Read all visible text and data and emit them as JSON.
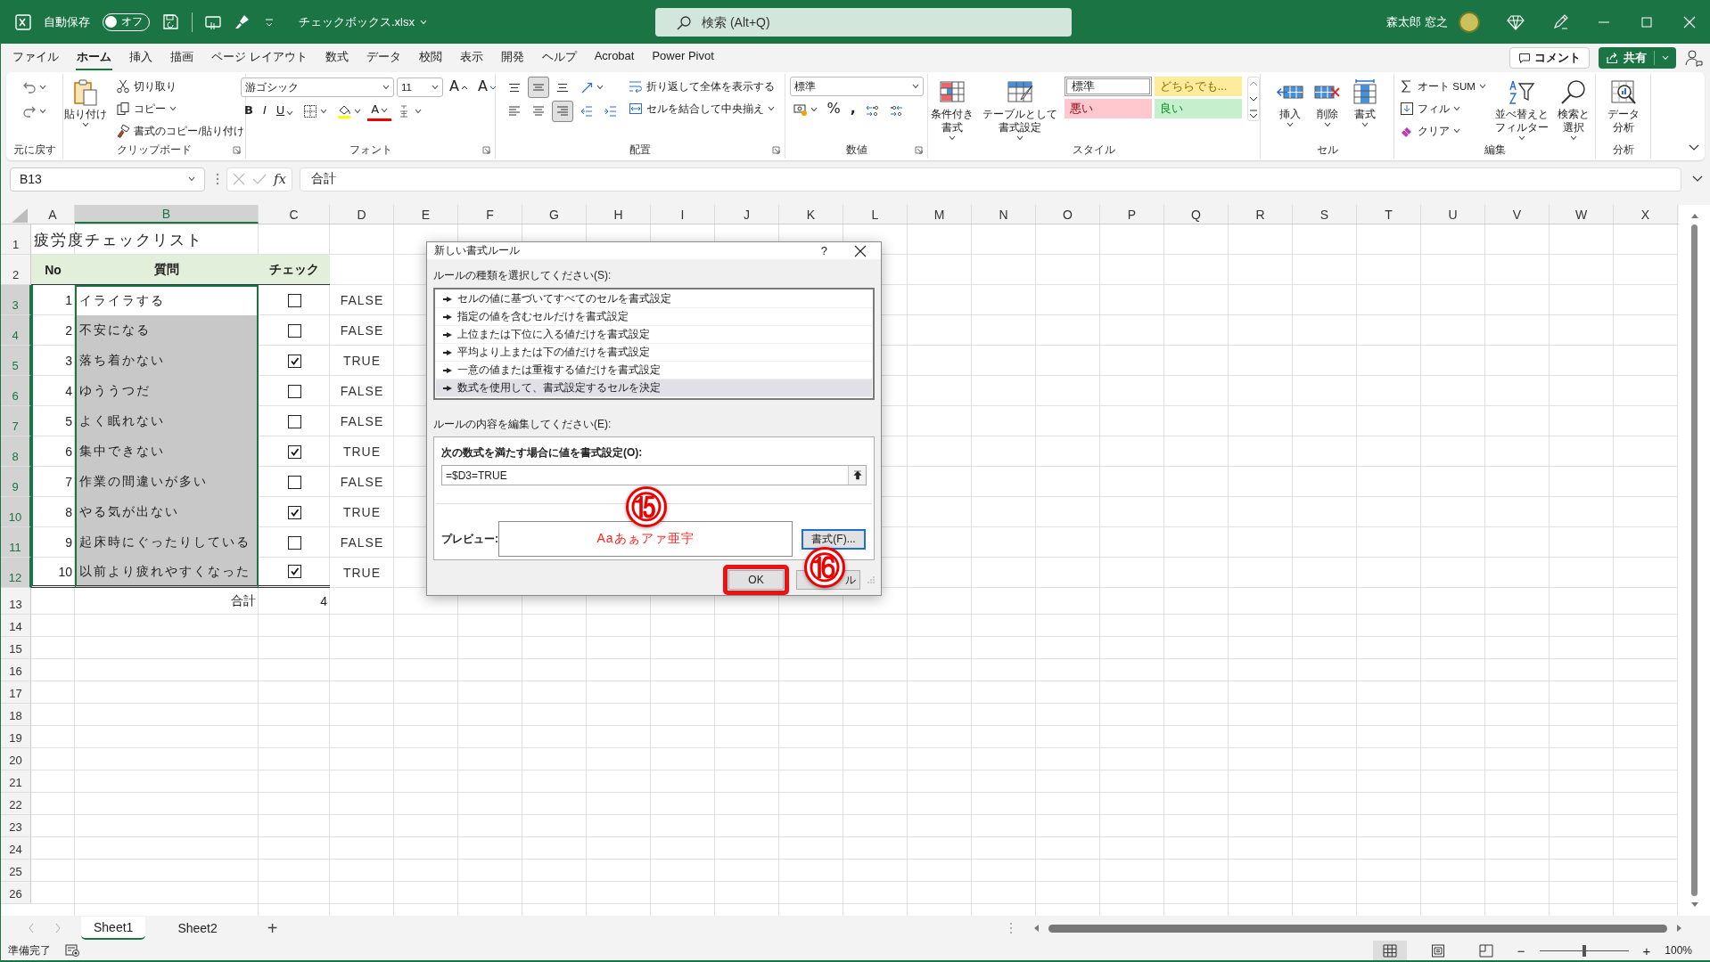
{
  "title_bar": {
    "autosave_label": "自動保存",
    "autosave": {
      "label": "オフ",
      "on": false
    },
    "filename": "チェックボックス.xlsx",
    "search": {
      "placeholder": "検索 (Alt+Q)"
    },
    "user_name": "森太郎 窓之"
  },
  "menu_tabs": [
    {
      "label": "ファイル",
      "selected": false
    },
    {
      "label": "ホーム",
      "selected": true
    },
    {
      "label": "挿入",
      "selected": false
    },
    {
      "label": "描画",
      "selected": false
    },
    {
      "label": "ページ レイアウト",
      "selected": false
    },
    {
      "label": "数式",
      "selected": false
    },
    {
      "label": "データ",
      "selected": false
    },
    {
      "label": "校閲",
      "selected": false
    },
    {
      "label": "表示",
      "selected": false
    },
    {
      "label": "開発",
      "selected": false
    },
    {
      "label": "ヘルプ",
      "selected": false
    },
    {
      "label": "Acrobat",
      "selected": false
    },
    {
      "label": "Power Pivot",
      "selected": false
    }
  ],
  "comment_button": "コメント",
  "share_button": "共有",
  "ribbon_groups": [
    {
      "label": "元に戻す",
      "launcher": false,
      "items": [
        {
          "kind": "icon",
          "menu": true,
          "pressed": false
        },
        {
          "kind": "icon",
          "menu": true,
          "pressed": false
        }
      ]
    },
    {
      "label": "クリップボード",
      "launcher": true,
      "items": [
        {
          "kind": "large",
          "label": "貼り付け",
          "menu": true
        },
        {
          "kind": "small",
          "label": "切り取り",
          "menu": false
        },
        {
          "kind": "small",
          "label": "コピー",
          "menu": true
        },
        {
          "kind": "small",
          "label": "書式のコピー/貼り付け",
          "menu": false
        }
      ]
    },
    {
      "label": "フォント",
      "launcher": true,
      "items": [
        {
          "kind": "dropdown",
          "label": "游ゴシック"
        },
        {
          "kind": "dropdown",
          "label": "11"
        },
        {
          "kind": "glyph",
          "label": "A",
          "menu": false
        },
        {
          "kind": "glyph",
          "label": "A",
          "menu": false
        },
        {
          "kind": "glyph",
          "label": "B",
          "menu": false
        },
        {
          "kind": "glyph",
          "label": "I",
          "menu": false
        },
        {
          "kind": "glyph",
          "label": "U",
          "menu": true
        },
        {
          "kind": "icon",
          "menu": true,
          "pressed": false
        },
        {
          "kind": "icon",
          "menu": true,
          "pressed": false
        },
        {
          "kind": "glyph",
          "label": "A",
          "menu": true
        },
        {
          "kind": "icon",
          "menu": true,
          "pressed": false
        }
      ]
    },
    {
      "label": "配置",
      "launcher": true,
      "items": [
        {
          "kind": "icon",
          "menu": false,
          "pressed": false
        },
        {
          "kind": "icon",
          "menu": false,
          "pressed": true
        },
        {
          "kind": "icon",
          "menu": false,
          "pressed": false
        },
        {
          "kind": "icon",
          "menu": true,
          "pressed": false
        },
        {
          "kind": "icon",
          "menu": false,
          "pressed": false
        },
        {
          "kind": "icon",
          "menu": false,
          "pressed": false
        },
        {
          "kind": "icon",
          "menu": false,
          "pressed": true
        },
        {
          "kind": "icon",
          "menu": false,
          "pressed": false
        },
        {
          "kind": "icon",
          "menu": false,
          "pressed": false
        },
        {
          "kind": "small",
          "label": "折り返して全体を表示する",
          "menu": false
        },
        {
          "kind": "small",
          "label": "セルを結合して中央揃え",
          "menu": true
        }
      ]
    },
    {
      "label": "数値",
      "launcher": true,
      "items": [
        {
          "kind": "dropdown",
          "label": "標準"
        },
        {
          "kind": "icon",
          "menu": true,
          "pressed": false
        },
        {
          "kind": "glyph",
          "label": "%",
          "menu": false
        },
        {
          "kind": "glyph",
          "label": ",",
          "menu": false
        },
        {
          "kind": "icon",
          "menu": false,
          "pressed": false
        },
        {
          "kind": "icon",
          "menu": false,
          "pressed": false
        }
      ]
    },
    {
      "label": "スタイル",
      "launcher": false,
      "items": [
        {
          "kind": "large",
          "lines": [
            "条件付き",
            "書式"
          ],
          "menu": true
        },
        {
          "kind": "large",
          "lines": [
            "テーブルとして",
            "書式設定"
          ],
          "menu": true
        }
      ],
      "styles": [
        {
          "label": "標準",
          "color": "#ffffff",
          "selected": true
        },
        {
          "label": "どちらでも...",
          "color": "#ffeb9c",
          "selected": false
        },
        {
          "label": "悪い",
          "color": "#ffc7ce",
          "selected": false
        },
        {
          "label": "良い",
          "color": "#c6efce",
          "selected": false
        }
      ]
    },
    {
      "label": "セル",
      "launcher": false,
      "items": [
        {
          "kind": "large",
          "label": "挿入",
          "menu": true
        },
        {
          "kind": "large",
          "label": "削除",
          "menu": true
        },
        {
          "kind": "large",
          "label": "書式",
          "menu": true
        }
      ]
    },
    {
      "label": "編集",
      "launcher": false,
      "items": [
        {
          "kind": "small",
          "label": "オート SUM",
          "menu": true
        },
        {
          "kind": "small",
          "label": "フィル",
          "menu": true
        },
        {
          "kind": "small",
          "label": "クリア",
          "menu": true
        },
        {
          "kind": "large",
          "lines": [
            "並べ替えと",
            "フィルター"
          ],
          "menu": true
        },
        {
          "kind": "large",
          "lines": [
            "検索と",
            "選択"
          ],
          "menu": true
        }
      ]
    },
    {
      "label": "分析",
      "items": [
        {
          "kind": "large",
          "lines": [
            "データ",
            "分析"
          ],
          "menu": false
        }
      ]
    }
  ],
  "formula_bar": {
    "name_box": "B13",
    "fx": "fx",
    "formula": "合計"
  },
  "sheet": {
    "columns": [
      {
        "label": "A",
        "selected": false
      },
      {
        "label": "B",
        "selected": true
      },
      {
        "label": "C",
        "selected": false
      },
      {
        "label": "D",
        "selected": false
      },
      {
        "label": "E",
        "selected": false
      },
      {
        "label": "F",
        "selected": false
      },
      {
        "label": "G",
        "selected": false
      },
      {
        "label": "H",
        "selected": false
      },
      {
        "label": "I",
        "selected": false
      },
      {
        "label": "J",
        "selected": false
      },
      {
        "label": "K",
        "selected": false
      },
      {
        "label": "L",
        "selected": false
      },
      {
        "label": "M",
        "selected": false
      },
      {
        "label": "N",
        "selected": false
      },
      {
        "label": "O",
        "selected": false
      },
      {
        "label": "P",
        "selected": false
      },
      {
        "label": "Q",
        "selected": false
      },
      {
        "label": "R",
        "selected": false
      },
      {
        "label": "S",
        "selected": false
      },
      {
        "label": "T",
        "selected": false
      },
      {
        "label": "U",
        "selected": false
      },
      {
        "label": "V",
        "selected": false
      },
      {
        "label": "W",
        "selected": false
      },
      {
        "label": "X",
        "selected": false
      }
    ],
    "rows": [
      {
        "label": "1",
        "selected": false
      },
      {
        "label": "2",
        "selected": false
      },
      {
        "label": "3",
        "selected": true
      },
      {
        "label": "4",
        "selected": true
      },
      {
        "label": "5",
        "selected": true
      },
      {
        "label": "6",
        "selected": true
      },
      {
        "label": "7",
        "selected": true
      },
      {
        "label": "8",
        "selected": true
      },
      {
        "label": "9",
        "selected": true
      },
      {
        "label": "10",
        "selected": true
      },
      {
        "label": "11",
        "selected": true
      },
      {
        "label": "12",
        "selected": true
      },
      {
        "label": "13",
        "selected": false
      },
      {
        "label": "14",
        "selected": false
      },
      {
        "label": "15",
        "selected": false
      },
      {
        "label": "16",
        "selected": false
      },
      {
        "label": "17",
        "selected": false
      },
      {
        "label": "18",
        "selected": false
      },
      {
        "label": "19",
        "selected": false
      },
      {
        "label": "20",
        "selected": false
      },
      {
        "label": "21",
        "selected": false
      },
      {
        "label": "22",
        "selected": false
      },
      {
        "label": "23",
        "selected": false
      },
      {
        "label": "24",
        "selected": false
      },
      {
        "label": "25",
        "selected": false
      },
      {
        "label": "26",
        "selected": false
      }
    ],
    "title": "疲労度チェックリスト",
    "headers": [
      "No",
      "質問",
      "チェック"
    ],
    "items": [
      {
        "no": "1",
        "question": "イライラする",
        "checked": false,
        "result": "FALSE",
        "active": true
      },
      {
        "no": "2",
        "question": "不安になる",
        "checked": false,
        "result": "FALSE",
        "active": false
      },
      {
        "no": "3",
        "question": "落ち着かない",
        "checked": true,
        "result": "TRUE",
        "active": false
      },
      {
        "no": "4",
        "question": "ゆううつだ",
        "checked": false,
        "result": "FALSE",
        "active": false
      },
      {
        "no": "5",
        "question": "よく眠れない",
        "checked": false,
        "result": "FALSE",
        "active": false
      },
      {
        "no": "6",
        "question": "集中できない",
        "checked": true,
        "result": "TRUE",
        "active": false
      },
      {
        "no": "7",
        "question": "作業の間違いが多い",
        "checked": false,
        "result": "FALSE",
        "active": false
      },
      {
        "no": "8",
        "question": "やる気が出ない",
        "checked": true,
        "result": "TRUE",
        "active": false
      },
      {
        "no": "9",
        "question": "起床時にぐったりしている",
        "checked": false,
        "result": "FALSE",
        "active": false
      },
      {
        "no": "10",
        "question": "以前より疲れやすくなった",
        "checked": true,
        "result": "TRUE",
        "active": false
      }
    ],
    "total_label": "合計",
    "total": "4"
  },
  "dialog": {
    "title": "新しい書式ルール",
    "help": "?",
    "rule_type_label": "ルールの種類を選択してください(S):",
    "rule_types": [
      {
        "label": "セルの値に基づいてすべてのセルを書式設定",
        "selected": false
      },
      {
        "label": "指定の値を含むセルだけを書式設定",
        "selected": false
      },
      {
        "label": "上位または下位に入る値だけを書式設定",
        "selected": false
      },
      {
        "label": "平均より上または下の値だけを書式設定",
        "selected": false
      },
      {
        "label": "一意の値または重複する値だけを書式設定",
        "selected": false
      },
      {
        "label": "数式を使用して、書式設定するセルを決定",
        "selected": true
      }
    ],
    "rule_edit_label": "ルールの内容を編集してください(E):",
    "formula_label": "次の数式を満たす場合に値を書式設定(O):",
    "formula": "=$D3=TRUE",
    "preview_label": "プレビュー:",
    "preview_text": "Aaあぁアァ亜宇",
    "format_button": "書式(F)...",
    "ok_button": "OK",
    "ok_highlighted": true,
    "cancel_button": "ル"
  },
  "callouts": [
    {
      "label": "⑮"
    },
    {
      "label": "⑯"
    }
  ],
  "sheet_tabs": [
    {
      "label": "Sheet1",
      "selected": true
    },
    {
      "label": "Sheet2",
      "selected": false
    }
  ],
  "add_sheet": "+",
  "status_bar": {
    "text": "準備完了",
    "views": [
      {
        "selected": true
      },
      {
        "selected": false
      },
      {
        "selected": false
      }
    ],
    "zoom_out": "−",
    "zoom_slider": {
      "level": 0.5
    },
    "zoom_in": "+",
    "zoom": "100%"
  }
}
